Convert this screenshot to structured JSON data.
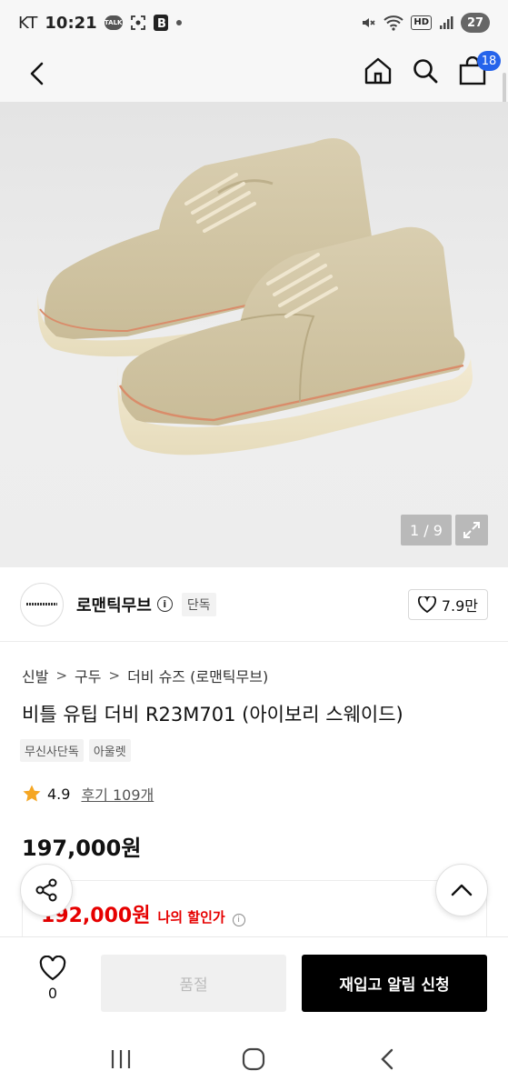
{
  "status_bar": {
    "carrier": "KT",
    "time": "10:21",
    "talk_label": "TALK",
    "battery": "27"
  },
  "header": {
    "icons": [
      "back-icon",
      "home-icon",
      "search-icon",
      "cart-icon"
    ],
    "cart_count": "18"
  },
  "gallery": {
    "counter": "1 / 9",
    "image_description_icon": "shoe-product-image"
  },
  "brand": {
    "name": "로맨틱무브",
    "badge": "단독",
    "likes": "7.9만"
  },
  "product": {
    "breadcrumb": [
      "신발",
      "구두",
      "더비 슈즈 (로맨틱무브)"
    ],
    "title": "비틀 유팁 더비 R23M701 (아이보리 스웨이드)",
    "tags": [
      "무신사단독",
      "아울렛"
    ],
    "rating": "4.9",
    "reviews": "후기 109개",
    "price": "197,000원",
    "discount_price": "192,000원",
    "discount_label": "나의 할인가"
  },
  "actions": {
    "wish_count": "0",
    "soldout_label": "품절",
    "restock_label": "재입고 알림 신청"
  },
  "colors": {
    "accent_blue": "#2563eb",
    "discount_red": "#e60000",
    "star": "#f5a623"
  }
}
